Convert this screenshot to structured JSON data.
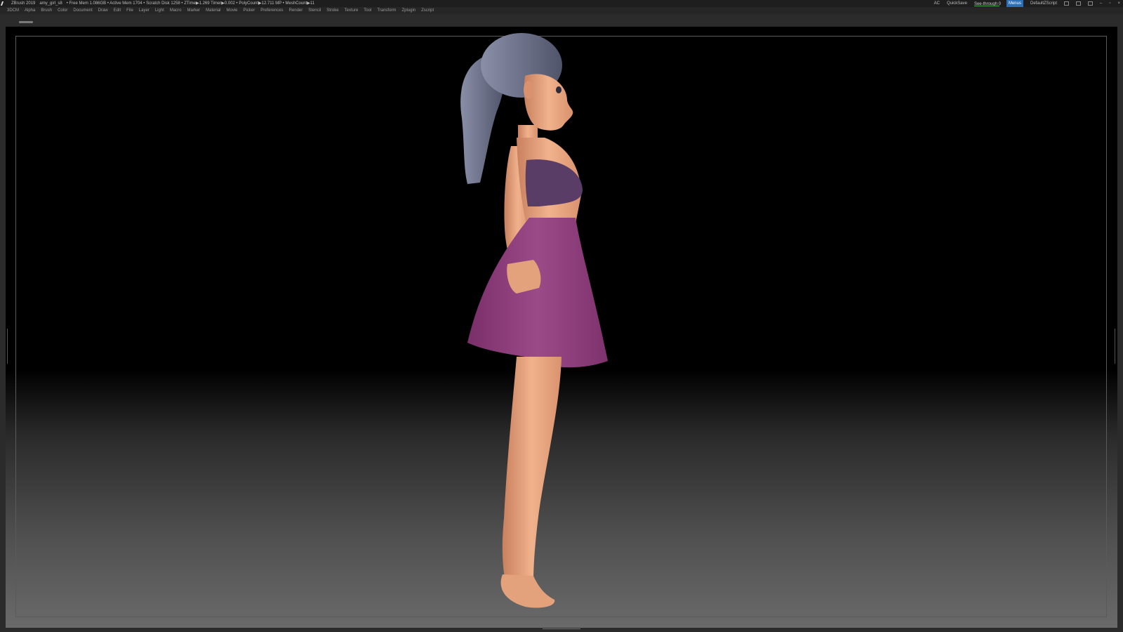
{
  "titlebar": {
    "app": "ZBrush 2019",
    "file": "amy_girl_s8",
    "stats": "• Free Mem 1.086GB • Active Mem 1704 • Scratch Disk 1258 •  ZTime▶1.269 Timer▶0.002 • PolyCount▶12.711 MP  • MeshCount▶11",
    "ac": "AC",
    "quicksave": "QuickSave",
    "see_through": "See-through  0",
    "menus_btn": "Menus",
    "script": "DefaultZScript"
  },
  "menus": [
    "3DCM",
    "Alpha",
    "Brush",
    "Color",
    "Document",
    "Draw",
    "Edit",
    "File",
    "Layer",
    "Light",
    "Macro",
    "Marker",
    "Material",
    "Movie",
    "Picker",
    "Preferences",
    "Render",
    "Stencil",
    "Stroke",
    "Texture",
    "Tool",
    "Transform",
    "Zplugin",
    "Zscript"
  ],
  "colors": {
    "skin": "#e3a27c",
    "skirt": "#8a3a78",
    "top": "#5a3d66",
    "hair": "#6c7086",
    "hair_tie": "#d987b8"
  },
  "icons": [
    "zbrush-logo-icon",
    "minimize-icon",
    "maximize-icon",
    "close-icon",
    "lock-icon",
    "scale-icon"
  ]
}
